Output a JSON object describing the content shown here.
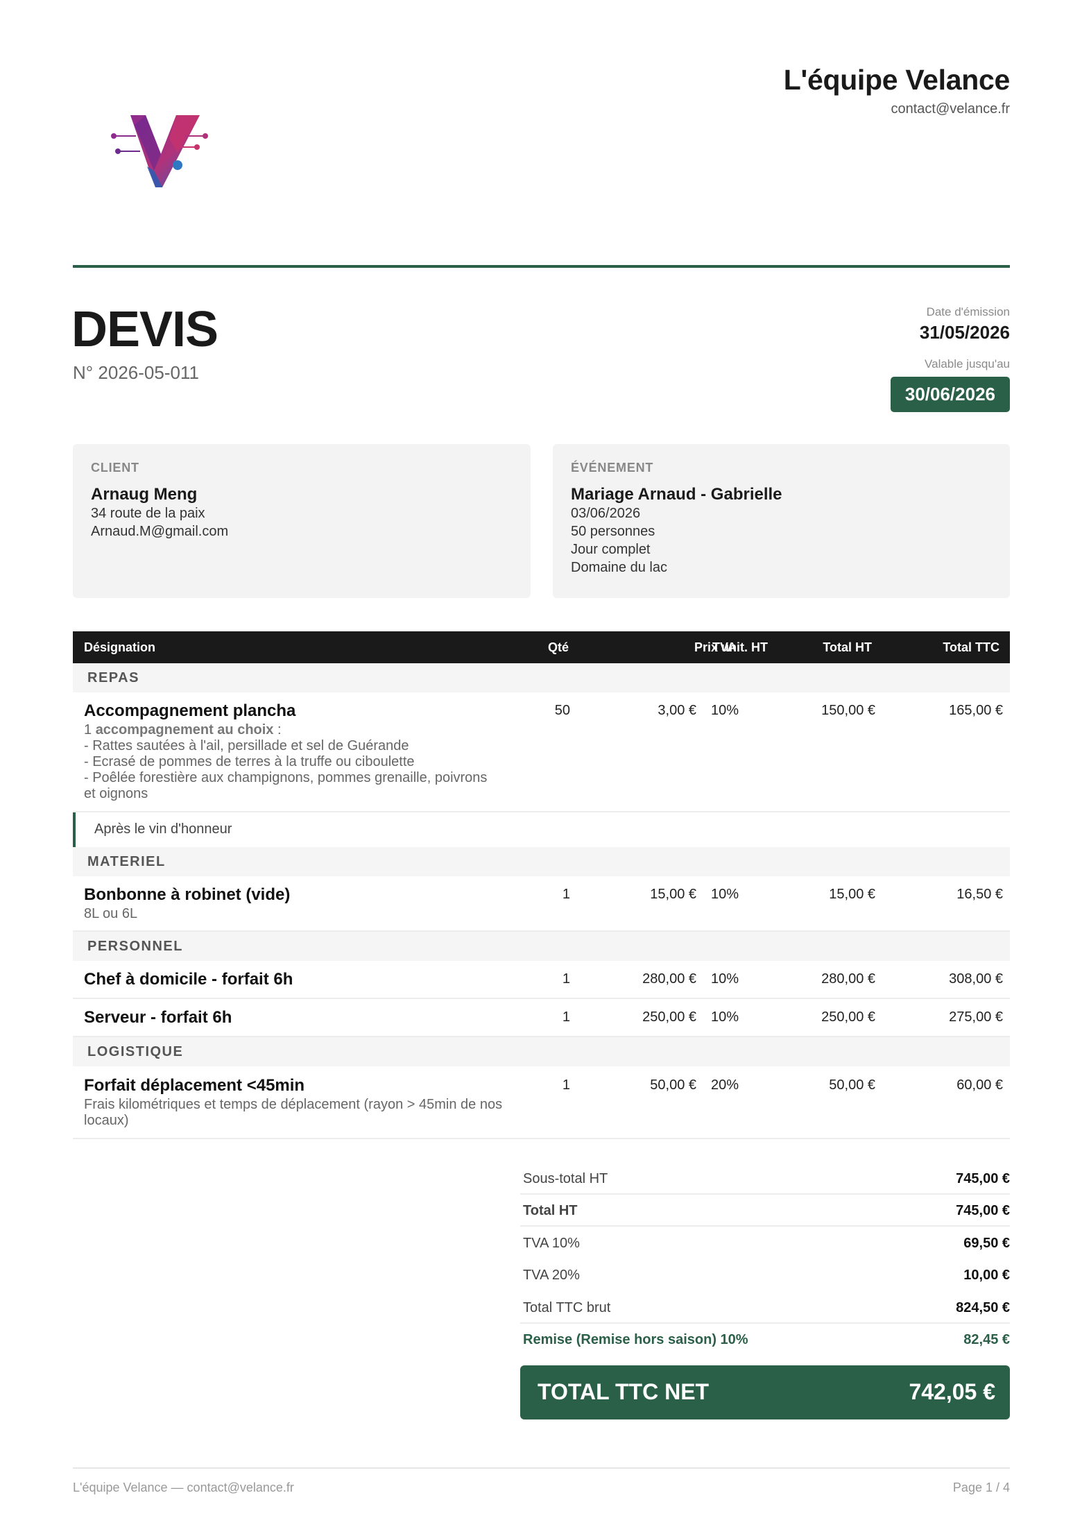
{
  "company": {
    "name": "L'équipe Velance",
    "email": "contact@velance.fr"
  },
  "document": {
    "title": "DEVIS",
    "number": "N° 2026-05-011",
    "issue_label": "Date d'émission",
    "issue_date": "31/05/2026",
    "valid_label": "Valable jusqu'au",
    "valid_date": "30/06/2026"
  },
  "client": {
    "heading": "CLIENT",
    "name": "Arnaug Meng",
    "address": "34 route de la paix",
    "email": "Arnaud.M@gmail.com"
  },
  "event": {
    "heading": "ÉVÉNEMENT",
    "name": "Mariage Arnaud - Gabrielle",
    "date": "03/06/2026",
    "guests": "50 personnes",
    "duration": "Jour complet",
    "venue": "Domaine du lac"
  },
  "table": {
    "headers": {
      "designation": "Désignation",
      "qty": "Qté",
      "unit_price": "Prix unit. HT",
      "vat": "TVA",
      "total_ht": "Total HT",
      "total_ttc": "Total TTC"
    },
    "sections": {
      "repas": "REPAS",
      "materiel": "MATERIEL",
      "personnel": "PERSONNEL",
      "logistique": "LOGISTIQUE"
    },
    "items": [
      {
        "title": "Accompagnement plancha",
        "desc_prefix": "1 ",
        "desc_bold": "accompagnement au choix",
        "desc_suffix": " :",
        "desc_lines": [
          "- Rattes sautées à l'ail, persillade et sel de Guérande",
          "- Ecrasé de pommes de terres à la truffe ou ciboulette",
          "- Poêlée forestière aux champignons, pommes grenaille, poivrons",
          "et oignons"
        ],
        "qty": "50",
        "unit_price": "3,00 €",
        "vat": "10%",
        "total_ht": "150,00 €",
        "total_ttc": "165,00 €"
      },
      {
        "title": "Bonbonne à robinet (vide)",
        "desc": "8L ou 6L",
        "qty": "1",
        "unit_price": "15,00 €",
        "vat": "10%",
        "total_ht": "15,00 €",
        "total_ttc": "16,50 €"
      },
      {
        "title": "Chef à domicile - forfait 6h",
        "qty": "1",
        "unit_price": "280,00 €",
        "vat": "10%",
        "total_ht": "280,00 €",
        "total_ttc": "308,00 €"
      },
      {
        "title": "Serveur - forfait 6h",
        "qty": "1",
        "unit_price": "250,00 €",
        "vat": "10%",
        "total_ht": "250,00 €",
        "total_ttc": "275,00 €"
      },
      {
        "title": "Forfait déplacement <45min",
        "desc_lines": [
          "Frais kilométriques et temps de déplacement (rayon > 45min de nos",
          "locaux)"
        ],
        "qty": "1",
        "unit_price": "50,00 €",
        "vat": "20%",
        "total_ht": "50,00 €",
        "total_ttc": "60,00 €"
      }
    ],
    "note": "Après le vin d'honneur"
  },
  "totals": {
    "subtotal_label": "Sous-total HT",
    "subtotal": "745,00 €",
    "total_ht_label": "Total HT",
    "total_ht": "745,00 €",
    "vat10_label": "TVA 10%",
    "vat10": "69,50 €",
    "vat20_label": "TVA 20%",
    "vat20": "10,00 €",
    "gross_label": "Total TTC brut",
    "gross": "824,50 €",
    "discount_label": "Remise (Remise hors saison) 10%",
    "discount": "82,45 €",
    "net_label": "TOTAL TTC NET",
    "net": "742,05 €"
  },
  "footer": {
    "left": "L'équipe Velance — contact@velance.fr",
    "right": "Page 1 / 4"
  },
  "colors": {
    "accent": "#2b6048",
    "header_bg": "#1a1a1a",
    "box_bg": "#f3f3f3"
  }
}
